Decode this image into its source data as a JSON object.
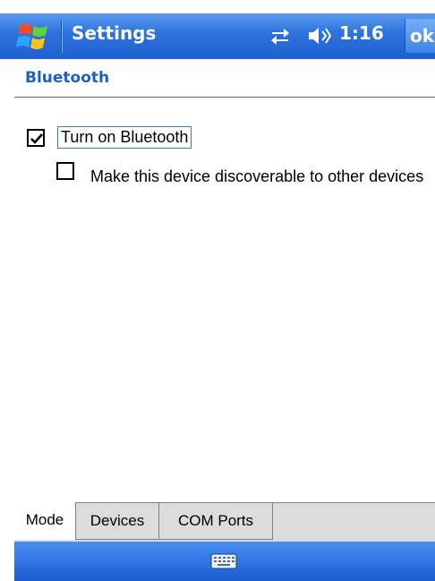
{
  "titlebar": {
    "title": "Settings",
    "clock": "1:16",
    "ok_label": "ok",
    "icons": [
      "windows-start-icon",
      "connectivity-icon",
      "volume-icon"
    ]
  },
  "section": {
    "title": "Bluetooth"
  },
  "options": {
    "bluetooth_on": {
      "label": "Turn on Bluetooth",
      "checked": true
    },
    "discoverable": {
      "label": "Make this device discoverable to other devices",
      "checked": false
    }
  },
  "tabs": [
    {
      "label": "Mode",
      "selected": true
    },
    {
      "label": "Devices",
      "selected": false
    },
    {
      "label": "COM Ports",
      "selected": false
    }
  ],
  "menubar": {
    "icons": [
      "keyboard-icon"
    ]
  },
  "colors": {
    "title_blue": "#2f74de",
    "section_title": "#1f5fbf"
  }
}
